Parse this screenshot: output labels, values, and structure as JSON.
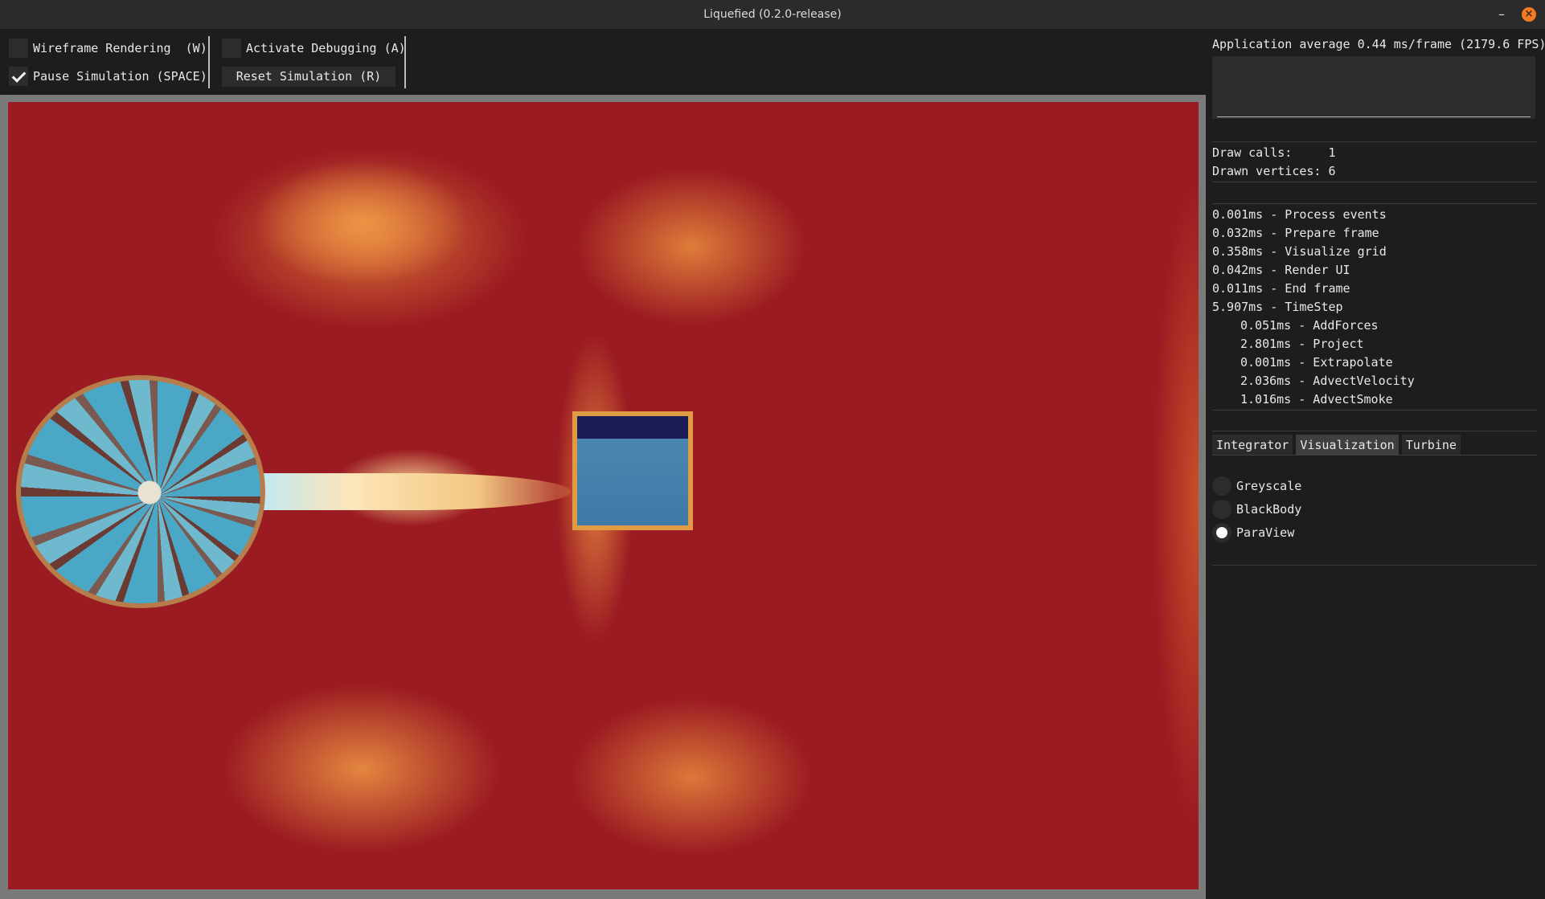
{
  "window": {
    "title": "Liquefied (0.2.0-release)",
    "minimize_glyph": "–",
    "close_glyph": "×"
  },
  "toolbar": {
    "wireframe_label": "Wireframe Rendering  (W)",
    "wireframe_checked": false,
    "pause_label": "Pause Simulation (SPACE)",
    "pause_checked": true,
    "debug_label": "Activate Debugging (A)",
    "debug_checked": false,
    "reset_label": "Reset Simulation (R)"
  },
  "stats": {
    "fps_line": "Application average 0.44 ms/frame (2179.6 FPS)",
    "draw_calls": "Draw calls:     1",
    "drawn_vertices": "Drawn vertices: 6"
  },
  "timings": [
    {
      "text": "0.001ms - Process events",
      "indent": false
    },
    {
      "text": "0.032ms - Prepare frame",
      "indent": false
    },
    {
      "text": "0.358ms - Visualize grid",
      "indent": false
    },
    {
      "text": "0.042ms - Render UI",
      "indent": false
    },
    {
      "text": "0.011ms - End frame",
      "indent": false
    },
    {
      "text": "5.907ms - TimeStep",
      "indent": false
    },
    {
      "text": "0.051ms - AddForces",
      "indent": true
    },
    {
      "text": "2.801ms - Project",
      "indent": true
    },
    {
      "text": "0.001ms - Extrapolate",
      "indent": true
    },
    {
      "text": "2.036ms - AdvectVelocity",
      "indent": true
    },
    {
      "text": "1.016ms - AdvectSmoke",
      "indent": true
    }
  ],
  "tabs": [
    {
      "label": "Integrator",
      "active": false
    },
    {
      "label": "Visualization",
      "active": true
    },
    {
      "label": "Turbine",
      "active": false
    }
  ],
  "visualization_options": [
    {
      "label": "Greyscale",
      "selected": false
    },
    {
      "label": "BlackBody",
      "selected": false
    },
    {
      "label": "ParaView",
      "selected": true
    }
  ],
  "colors": {
    "accent_close": "#f47a1f",
    "panel_bg": "#1d1d1d",
    "widget_bg": "#2c2c2c",
    "smoke_base": "#9b1b22"
  }
}
